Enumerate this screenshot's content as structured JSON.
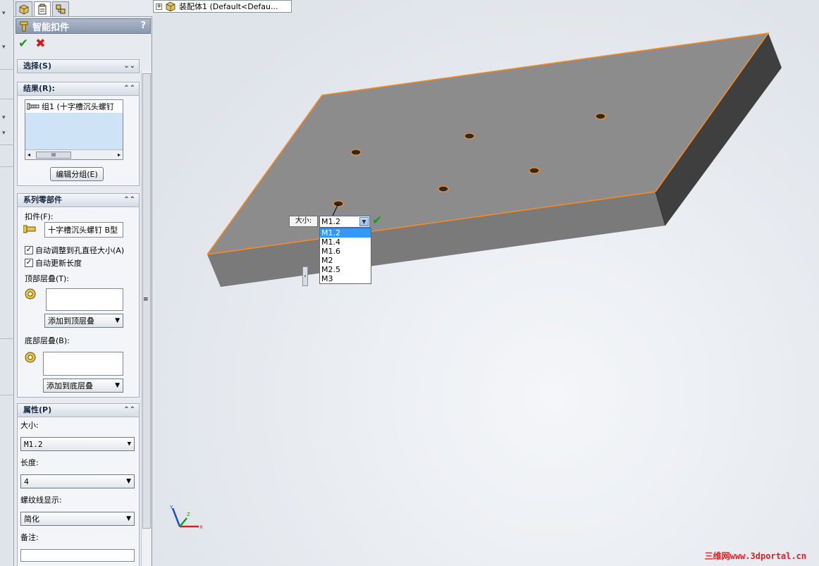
{
  "panel": {
    "title": "智能扣件",
    "help": "?",
    "sections": {
      "selection": {
        "title": "选择(S)"
      },
      "results": {
        "title": "结果(R):",
        "items": [
          {
            "label": "组1 (十字槽沉头螺钉"
          }
        ],
        "edit_button": "编辑分组(E)"
      },
      "series": {
        "title": "系列零部件",
        "fastener_label": "扣件(F):",
        "fastener_value": "十字槽沉头螺钉 B型",
        "auto_resize_label": "自动调整到孔直径大小(A)",
        "auto_resize_checked": true,
        "auto_length_label": "自动更新长度",
        "auto_length_checked": true,
        "top_stack_label": "顶部层叠(T):",
        "top_stack_combo": "添加到顶层叠",
        "bottom_stack_label": "底部层叠(B):",
        "bottom_stack_combo": "添加到底层叠"
      },
      "properties": {
        "title": "属性(P)",
        "size_label": "大小:",
        "size_value": "M1.2",
        "length_label": "长度:",
        "length_value": "4",
        "thread_label": "螺纹线显示:",
        "thread_value": "简化",
        "notes_label": "备注:",
        "notes_value": ""
      }
    }
  },
  "viewport": {
    "tree_node": "装配体1  (Default<Defau...",
    "size_popup": {
      "label": "大小:",
      "value": "M1.2",
      "options": [
        "M1.2",
        "M1.4",
        "M1.6",
        "M2",
        "M2.5",
        "M3"
      ],
      "selected_index": 0
    },
    "triad": {
      "x": "X",
      "y": "Y",
      "z": "Z"
    },
    "watermark": "三维网www.3dportal.cn"
  },
  "colors": {
    "accent_select": "#3399ff",
    "edge_highlight": "#ff8a1e",
    "part_top": "#8c8c8c",
    "part_front": "#7a7a7a",
    "part_side": "#3f3f3f",
    "ok": "#1a9a1a",
    "cancel": "#d01818"
  }
}
